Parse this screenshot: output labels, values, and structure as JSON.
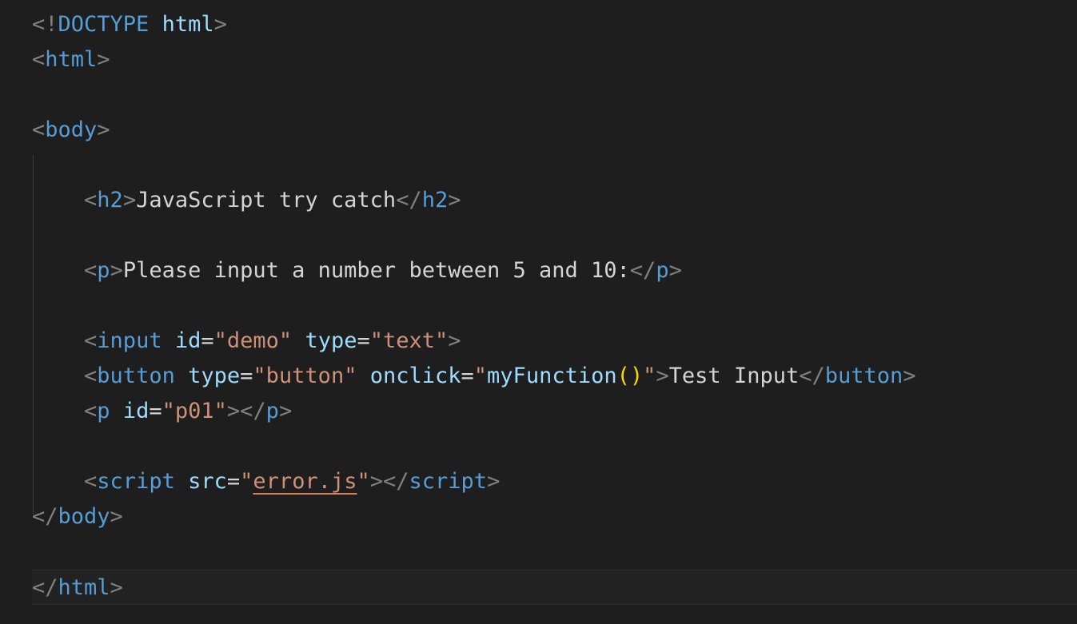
{
  "editor": {
    "lines": [
      {
        "segments": [
          {
            "t": "<!",
            "c": "punc"
          },
          {
            "t": "DOCTYPE",
            "c": "decl"
          },
          {
            "t": " ",
            "c": "text"
          },
          {
            "t": "html",
            "c": "decl-name"
          },
          {
            "t": ">",
            "c": "punc"
          }
        ]
      },
      {
        "segments": [
          {
            "t": "<",
            "c": "punc"
          },
          {
            "t": "html",
            "c": "tag"
          },
          {
            "t": ">",
            "c": "punc"
          }
        ]
      },
      {
        "segments": []
      },
      {
        "segments": [
          {
            "t": "<",
            "c": "punc"
          },
          {
            "t": "body",
            "c": "tag"
          },
          {
            "t": ">",
            "c": "punc"
          }
        ]
      },
      {
        "segments": []
      },
      {
        "segments": [
          {
            "t": "    ",
            "c": "text"
          },
          {
            "t": "<",
            "c": "punc"
          },
          {
            "t": "h2",
            "c": "tag"
          },
          {
            "t": ">",
            "c": "punc"
          },
          {
            "t": "JavaScript try catch",
            "c": "text"
          },
          {
            "t": "</",
            "c": "punc"
          },
          {
            "t": "h2",
            "c": "tag"
          },
          {
            "t": ">",
            "c": "punc"
          }
        ]
      },
      {
        "segments": []
      },
      {
        "segments": [
          {
            "t": "    ",
            "c": "text"
          },
          {
            "t": "<",
            "c": "punc"
          },
          {
            "t": "p",
            "c": "tag"
          },
          {
            "t": ">",
            "c": "punc"
          },
          {
            "t": "Please input a number between 5 and 10:",
            "c": "text"
          },
          {
            "t": "</",
            "c": "punc"
          },
          {
            "t": "p",
            "c": "tag"
          },
          {
            "t": ">",
            "c": "punc"
          }
        ]
      },
      {
        "segments": []
      },
      {
        "segments": [
          {
            "t": "    ",
            "c": "text"
          },
          {
            "t": "<",
            "c": "punc"
          },
          {
            "t": "input",
            "c": "tag"
          },
          {
            "t": " ",
            "c": "text"
          },
          {
            "t": "id",
            "c": "attr"
          },
          {
            "t": "=",
            "c": "eq"
          },
          {
            "t": "\"demo\"",
            "c": "str"
          },
          {
            "t": " ",
            "c": "text"
          },
          {
            "t": "type",
            "c": "attr"
          },
          {
            "t": "=",
            "c": "eq"
          },
          {
            "t": "\"text\"",
            "c": "str"
          },
          {
            "t": ">",
            "c": "punc"
          }
        ]
      },
      {
        "segments": [
          {
            "t": "    ",
            "c": "text"
          },
          {
            "t": "<",
            "c": "punc"
          },
          {
            "t": "button",
            "c": "tag"
          },
          {
            "t": " ",
            "c": "text"
          },
          {
            "t": "type",
            "c": "attr"
          },
          {
            "t": "=",
            "c": "eq"
          },
          {
            "t": "\"button\"",
            "c": "str"
          },
          {
            "t": " ",
            "c": "text"
          },
          {
            "t": "onclick",
            "c": "attr"
          },
          {
            "t": "=",
            "c": "eq"
          },
          {
            "t": "\"",
            "c": "str"
          },
          {
            "t": "myFunction",
            "c": "attr"
          },
          {
            "t": "()",
            "c": "paren"
          },
          {
            "t": "\"",
            "c": "str"
          },
          {
            "t": ">",
            "c": "punc"
          },
          {
            "t": "Test Input",
            "c": "text"
          },
          {
            "t": "</",
            "c": "punc"
          },
          {
            "t": "button",
            "c": "tag"
          },
          {
            "t": ">",
            "c": "punc"
          }
        ]
      },
      {
        "segments": [
          {
            "t": "    ",
            "c": "text"
          },
          {
            "t": "<",
            "c": "punc"
          },
          {
            "t": "p",
            "c": "tag"
          },
          {
            "t": " ",
            "c": "text"
          },
          {
            "t": "id",
            "c": "attr"
          },
          {
            "t": "=",
            "c": "eq"
          },
          {
            "t": "\"p01\"",
            "c": "str"
          },
          {
            "t": ">",
            "c": "punc"
          },
          {
            "t": "</",
            "c": "punc"
          },
          {
            "t": "p",
            "c": "tag"
          },
          {
            "t": ">",
            "c": "punc"
          }
        ]
      },
      {
        "segments": []
      },
      {
        "segments": [
          {
            "t": "    ",
            "c": "text"
          },
          {
            "t": "<",
            "c": "punc"
          },
          {
            "t": "script",
            "c": "tag"
          },
          {
            "t": " ",
            "c": "text"
          },
          {
            "t": "src",
            "c": "attr"
          },
          {
            "t": "=",
            "c": "eq"
          },
          {
            "t": "\"",
            "c": "str"
          },
          {
            "t": "error.js",
            "c": "str",
            "squiggle": true
          },
          {
            "t": "\"",
            "c": "str"
          },
          {
            "t": ">",
            "c": "punc"
          },
          {
            "t": "</",
            "c": "punc"
          },
          {
            "t": "script",
            "c": "tag"
          },
          {
            "t": ">",
            "c": "punc"
          }
        ]
      },
      {
        "segments": [
          {
            "t": "</",
            "c": "punc"
          },
          {
            "t": "body",
            "c": "tag"
          },
          {
            "t": ">",
            "c": "punc"
          }
        ]
      },
      {
        "segments": []
      },
      {
        "segments": [
          {
            "t": "</",
            "c": "punc"
          },
          {
            "t": "html",
            "c": "tag"
          },
          {
            "t": ">",
            "c": "punc"
          }
        ],
        "current": true
      }
    ]
  }
}
